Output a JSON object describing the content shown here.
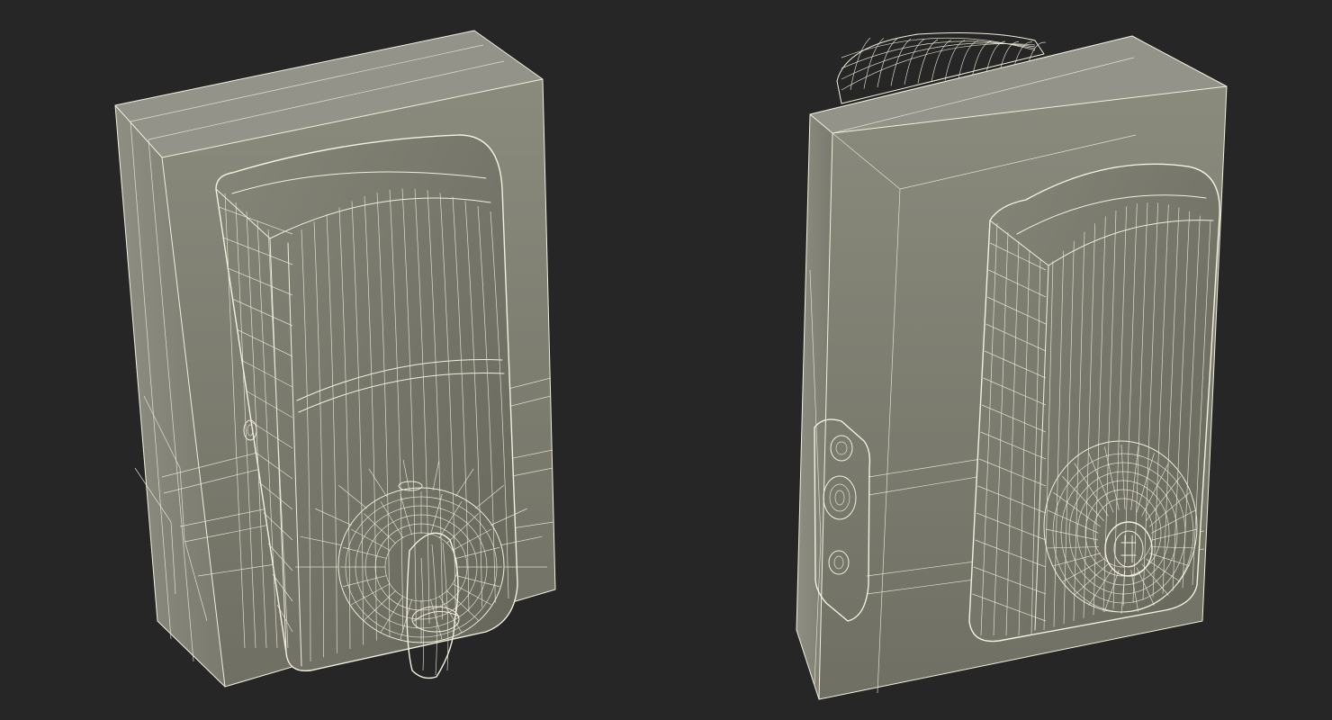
{
  "scene": {
    "background_color": "#262626",
    "surface_color": "#7d7d70",
    "wire_color": "#f2efdc"
  },
  "models": [
    {
      "view": "front",
      "parts": [
        "backplate",
        "keypad-housing",
        "thumb-turn"
      ]
    },
    {
      "view": "back",
      "parts": [
        "backplate",
        "latch-faceplate",
        "interior-housing",
        "key-cylinder"
      ]
    }
  ]
}
